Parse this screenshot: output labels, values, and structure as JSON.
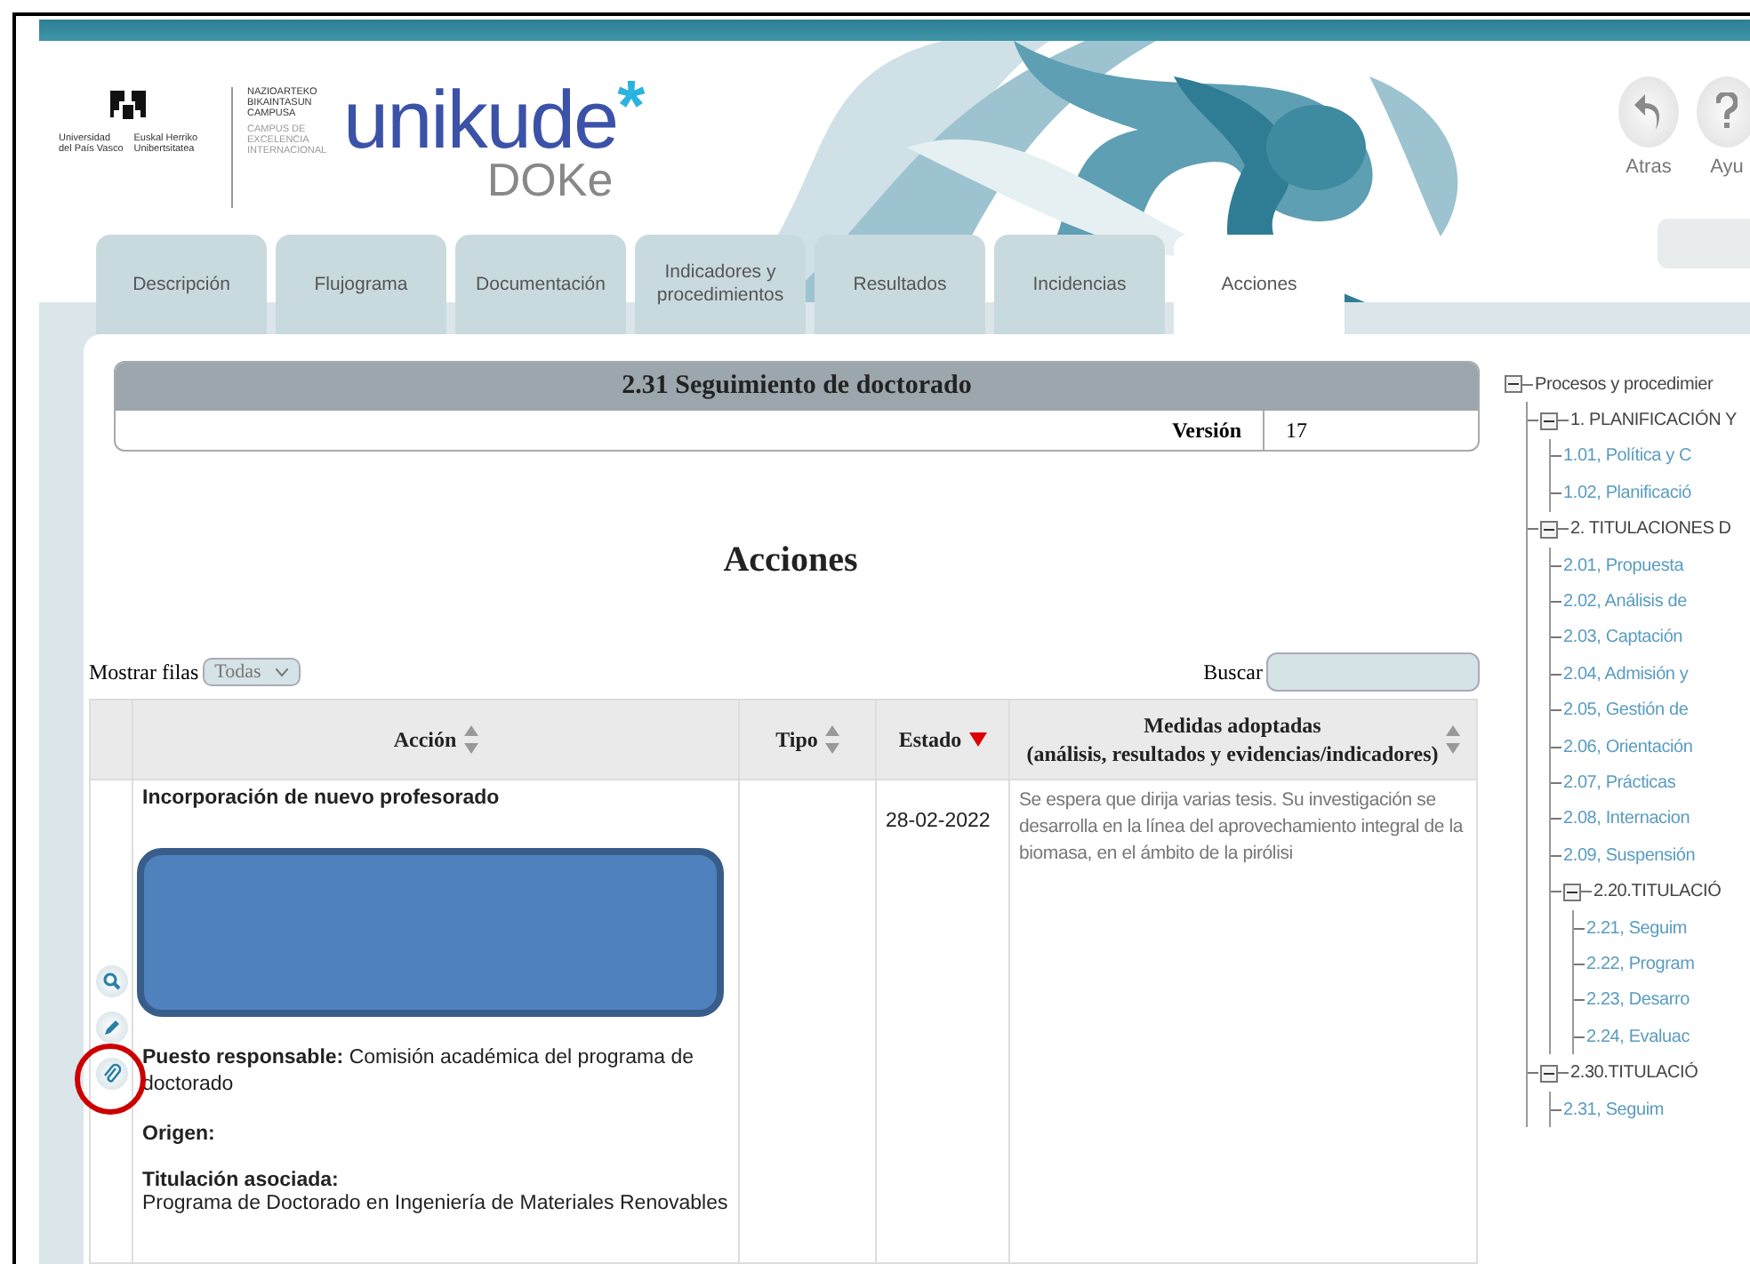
{
  "header": {
    "university_lines": [
      "Universidad",
      "del País Vasco"
    ],
    "university_lines_eu": [
      "Euskal Herriko",
      "Unibertsitatea"
    ],
    "campus_lines": [
      "NAZIOARTEKO",
      "BIKAINTASUN",
      "CAMPUSA"
    ],
    "campus_lines_es": [
      "CAMPUS DE",
      "EXCELENCIA",
      "INTERNACIONAL"
    ],
    "brand": "unikude",
    "brand_mark": "*",
    "brand_sub": "DOKe",
    "buttons": [
      {
        "kind": "back",
        "label": "Atras"
      },
      {
        "kind": "help",
        "label": "Ayu"
      }
    ]
  },
  "tabs": [
    {
      "label": "Descripción",
      "selected": false
    },
    {
      "label": "Flujograma",
      "selected": false
    },
    {
      "label": "Documentación",
      "selected": false
    },
    {
      "label": "Indicadores y procedimientos",
      "selected": false
    },
    {
      "label": "Resultados",
      "selected": false
    },
    {
      "label": "Incidencias",
      "selected": false
    },
    {
      "label": "Acciones",
      "selected": true
    }
  ],
  "process": {
    "title": "2.31 Seguimiento de doctorado",
    "version_label": "Versión",
    "version": "17"
  },
  "heading": "Acciones",
  "show_rows": {
    "label": "Mostrar filas",
    "value": "Todas"
  },
  "search": {
    "label": "Buscar"
  },
  "table": {
    "columns": [
      {
        "label": "Acción",
        "sorted": false
      },
      {
        "label": "Tipo",
        "sorted": false
      },
      {
        "label": "Estado",
        "sorted": true
      },
      {
        "label": "Medidas adoptadas",
        "sublabel": "(análisis, resultados y evidencias/indicadores)",
        "sorted": false
      }
    ],
    "rows": [
      {
        "title": "Incorporación de nuevo profesorado",
        "responsible": "**Puesto responsable:** Comisión académica del programa de doctorado",
        "origin_label": "Origen:",
        "degree_label": "Titulación asociada:",
        "degree": "Programa de Doctorado en Ingeniería de Materiales Renovables",
        "estado": "28-02-2022",
        "medidas": "Se espera que dirija varias tesis. Su investigación se desarrolla en la línea del aprovechamiento integral de la biomasa, en el ámbito de la pirólisi",
        "redacted": true,
        "attach_highlighted": true
      }
    ]
  },
  "tree": {
    "label": "Procesos y procedimier",
    "expanded": true,
    "children": [
      {
        "label": "1. PLANIFICACIÓN Y",
        "expanded": true,
        "children": [
          {
            "label": "1.01, Política y C"
          },
          {
            "label": "1.02, Planificació"
          }
        ]
      },
      {
        "label": "2. TITULACIONES D",
        "expanded": true,
        "children": [
          {
            "label": "2.01, Propuesta"
          },
          {
            "label": "2.02, Análisis de"
          },
          {
            "label": "2.03, Captación"
          },
          {
            "label": "2.04, Admisión y"
          },
          {
            "label": "2.05, Gestión de"
          },
          {
            "label": "2.06, Orientación"
          },
          {
            "label": "2.07, Prácticas"
          },
          {
            "label": "2.08, Internacion"
          },
          {
            "label": "2.09, Suspensión"
          },
          {
            "label": "2.20.TITULACIÓ",
            "expanded": true,
            "children": [
              {
                "label": "2.21, Seguim"
              },
              {
                "label": "2.22, Program"
              },
              {
                "label": "2.23, Desarro"
              },
              {
                "label": "2.24, Evaluac"
              }
            ]
          }
        ]
      },
      {
        "label": "2.30.TITULACIÓ",
        "expanded": true,
        "children": [
          {
            "label": "2.31, Seguim"
          }
        ]
      }
    ]
  }
}
